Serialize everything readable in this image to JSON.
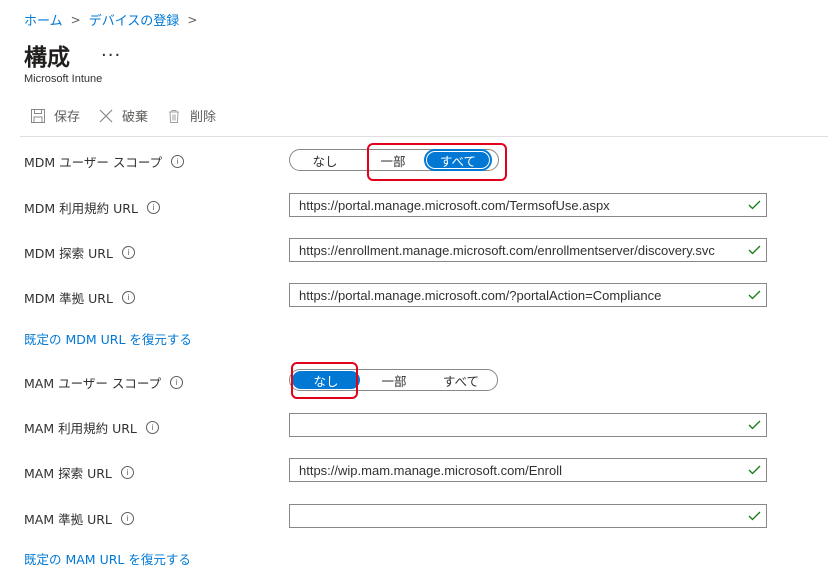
{
  "breadcrumb": {
    "home": "ホーム",
    "enroll": "デバイスの登録"
  },
  "header": {
    "title": "構成",
    "more": "...",
    "subtitle": "Microsoft Intune"
  },
  "toolbar": {
    "save": "保存",
    "discard": "破棄",
    "delete": "削除"
  },
  "mdm": {
    "user_scope_label": "MDM ユーザー スコープ",
    "user_scope_options": [
      "なし",
      "一部",
      "すべて"
    ],
    "user_scope_selected": "すべて",
    "terms_label": "MDM 利用規約 URL",
    "terms_value": "https://portal.manage.microsoft.com/TermsofUse.aspx",
    "discovery_label": "MDM 探索 URL",
    "discovery_value": "https://enrollment.manage.microsoft.com/enrollmentserver/discovery.svc",
    "compliance_label": "MDM 準拠 URL",
    "compliance_value": "https://portal.manage.microsoft.com/?portalAction=Compliance",
    "restore_link": "既定の MDM URL を復元する"
  },
  "mam": {
    "user_scope_label": "MAM ユーザー スコープ",
    "user_scope_options": [
      "なし",
      "一部",
      "すべて"
    ],
    "user_scope_selected": "なし",
    "terms_label": "MAM 利用規約 URL",
    "terms_value": "",
    "discovery_label": "MAM 探索 URL",
    "discovery_value": "https://wip.mam.manage.microsoft.com/Enroll",
    "compliance_label": "MAM 準拠 URL",
    "compliance_value": "",
    "restore_link": "既定の MAM URL を復元する"
  },
  "colors": {
    "accent": "#0078d4",
    "highlight": "#e3001b",
    "valid": "#107c10"
  }
}
